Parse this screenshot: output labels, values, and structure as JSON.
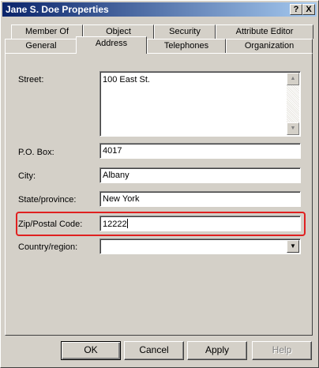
{
  "window": {
    "title": "Jane S. Doe Properties",
    "help_button": "?",
    "close_button": "X"
  },
  "tabs_row1": [
    {
      "label": "Member Of"
    },
    {
      "label": "Object"
    },
    {
      "label": "Security"
    },
    {
      "label": "Attribute Editor"
    }
  ],
  "tabs_row2": [
    {
      "label": "General"
    },
    {
      "label": "Address",
      "active": true
    },
    {
      "label": "Telephones"
    },
    {
      "label": "Organization"
    }
  ],
  "form": {
    "street_label": "Street:",
    "street_value": "100 East St.",
    "po_box_label": "P.O. Box:",
    "po_box_value": "4017",
    "city_label": "City:",
    "city_value": "Albany",
    "state_label": "State/province:",
    "state_value": "New York",
    "zip_label": "Zip/Postal Code:",
    "zip_value": "12222",
    "country_label": "Country/region:",
    "country_value": ""
  },
  "buttons": {
    "ok": "OK",
    "cancel": "Cancel",
    "apply": "Apply",
    "help": "Help"
  },
  "colors": {
    "highlight": "#e02020",
    "title_bar": "#0a246a"
  }
}
